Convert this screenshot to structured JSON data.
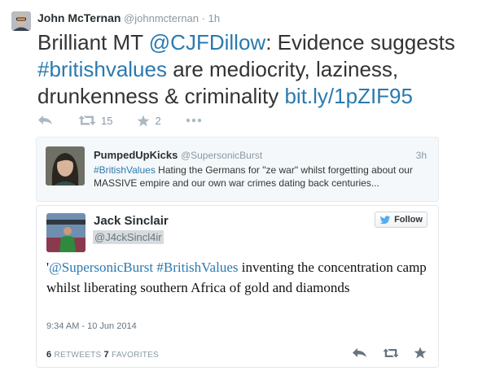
{
  "main_tweet": {
    "name": "John McTernan",
    "handle": "@johnmcternan",
    "separator": "·",
    "time": "1h",
    "text_prefix": "Brilliant MT ",
    "mention": "@CJFDillow",
    "text_mid": ": Evidence suggests ",
    "hashtag": "#britishvalues",
    "text_rest": " are mediocrity, laziness, drunkenness & criminality ",
    "link": "bit.ly/1pZIF95",
    "retweets": "15",
    "favorites": "2",
    "icons": [
      "reply-icon",
      "retweet-icon",
      "star-icon",
      "more-icon"
    ]
  },
  "quoted_tweet": {
    "name": "PumpedUpKicks",
    "handle": "@SupersonicBurst",
    "time": "3h",
    "hashtag": "#BritishValues",
    "text": " Hating the Germans for \"ze war\" whilst forgetting about our MASSIVE empire and our own war crimes dating back centuries..."
  },
  "embedded_tweet": {
    "name": "Jack Sinclair",
    "handle": "@J4ckSincl4ir",
    "follow_label": "Follow",
    "quote_mark": "'",
    "mention": "@SupersonicBurst",
    "space": " ",
    "hashtag": "#BritishValues",
    "text": " inventing the concentration camp whilst liberating southern Africa of gold and diamonds",
    "timestamp": "9:34 AM - 10 Jun 2014",
    "retweet_count": "6",
    "retweet_label": " RETWEETS ",
    "favorite_count": "7",
    "favorite_label": " FAVORITES",
    "icons": [
      "twitter-bird-icon",
      "reply-icon",
      "retweet-icon",
      "star-icon"
    ]
  },
  "colors": {
    "link": "#2a7ab0",
    "muted": "#8899a6",
    "icon": "#aab8c2",
    "card_bg": "#f5f8fa",
    "twitter_blue": "#55acee"
  }
}
